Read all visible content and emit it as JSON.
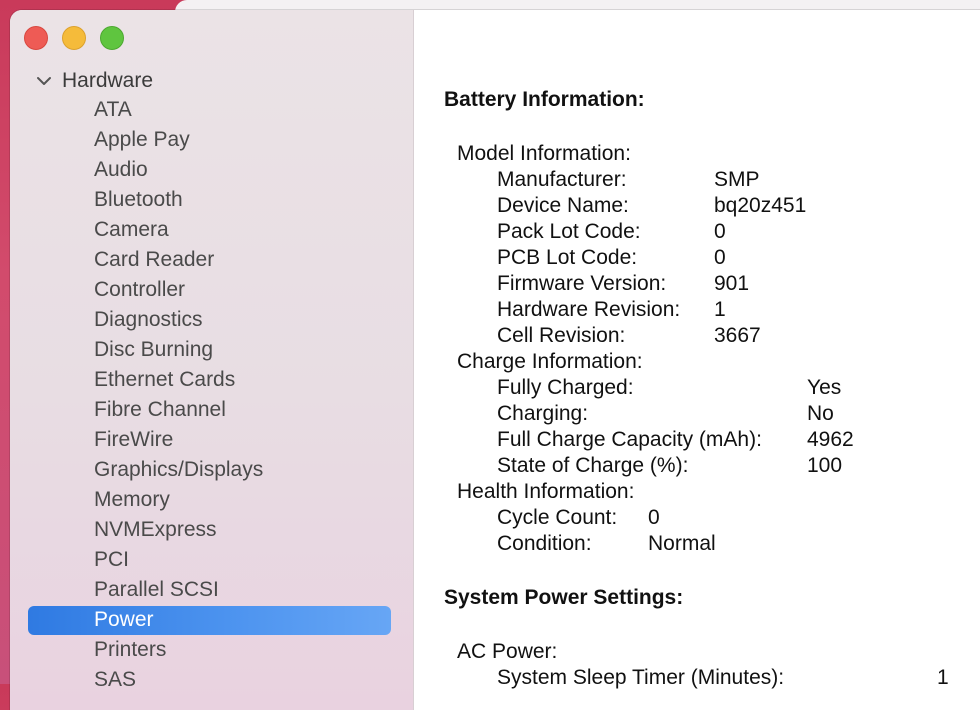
{
  "sidebar": {
    "section_label": "Hardware",
    "items": [
      "ATA",
      "Apple Pay",
      "Audio",
      "Bluetooth",
      "Camera",
      "Card Reader",
      "Controller",
      "Diagnostics",
      "Disc Burning",
      "Ethernet Cards",
      "Fibre Channel",
      "FireWire",
      "Graphics/Displays",
      "Memory",
      "NVMExpress",
      "PCI",
      "Parallel SCSI",
      "Power",
      "Printers",
      "SAS"
    ],
    "selected_item": "Power"
  },
  "content": {
    "battery_title": "Battery Information:",
    "model_header": "Model Information:",
    "model_rows": [
      {
        "label": "Manufacturer:",
        "value": "SMP"
      },
      {
        "label": "Device Name:",
        "value": "bq20z451"
      },
      {
        "label": "Pack Lot Code:",
        "value": "0"
      },
      {
        "label": "PCB Lot Code:",
        "value": "0"
      },
      {
        "label": "Firmware Version:",
        "value": "901"
      },
      {
        "label": "Hardware Revision:",
        "value": "1"
      },
      {
        "label": "Cell Revision:",
        "value": "3667"
      }
    ],
    "charge_header": "Charge Information:",
    "charge_rows": [
      {
        "label": "Fully Charged:",
        "value": "Yes"
      },
      {
        "label": "Charging:",
        "value": "No"
      },
      {
        "label": "Full Charge Capacity (mAh):",
        "value": "4962"
      },
      {
        "label": "State of Charge (%):",
        "value": "100"
      }
    ],
    "health_header": "Health Information:",
    "health_rows": [
      {
        "label": "Cycle Count:",
        "value": "0"
      },
      {
        "label": "Condition:",
        "value": "Normal"
      }
    ],
    "system_title": "System Power Settings:",
    "ac_header": "AC Power:",
    "ac_rows": [
      {
        "label": "System Sleep Timer (Minutes):",
        "value": "1"
      }
    ]
  }
}
